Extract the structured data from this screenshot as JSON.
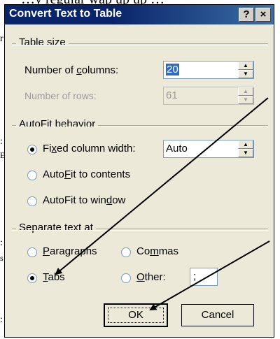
{
  "background_fragments": {
    "top": "…y regular wap up up …",
    "left_r": "r",
    "left_1": ":",
    "left_2": "E",
    "left_3": ":",
    "left_4": "s",
    "left_5": ":"
  },
  "dialog": {
    "title": "Convert Text to Table",
    "help_button": "?",
    "close_button": "×"
  },
  "table_size": {
    "label": "Table size",
    "columns_label_pre": "Number of ",
    "columns_label_u": "c",
    "columns_label_post": "olumns:",
    "columns_value": "20",
    "rows_label": "Number of rows:",
    "rows_value": "61"
  },
  "autofit": {
    "label": "AutoFit behavior",
    "fixed_pre": "Fi",
    "fixed_u": "x",
    "fixed_post": "ed column width:",
    "fixed_value": "Auto",
    "contents_pre": "Auto",
    "contents_u": "F",
    "contents_post": "it to contents",
    "window_pre": "AutoFit to win",
    "window_u": "d",
    "window_post": "ow"
  },
  "separate": {
    "label": "Separate text at",
    "paragraphs_u": "P",
    "paragraphs_post": "aragraphs",
    "commas_pre": "Co",
    "commas_u": "m",
    "commas_post": "mas",
    "tabs_u": "T",
    "tabs_post": "abs",
    "other_u": "O",
    "other_post": "ther:",
    "other_value": ";"
  },
  "buttons": {
    "ok": "OK",
    "cancel": "Cancel"
  },
  "state": {
    "autofit_selected": "fixed",
    "separator_selected": "tabs"
  },
  "colors": {
    "titlebar": "#0a246a",
    "dialog_bg": "#ece9d8",
    "annotation_arrows": "#000000"
  }
}
